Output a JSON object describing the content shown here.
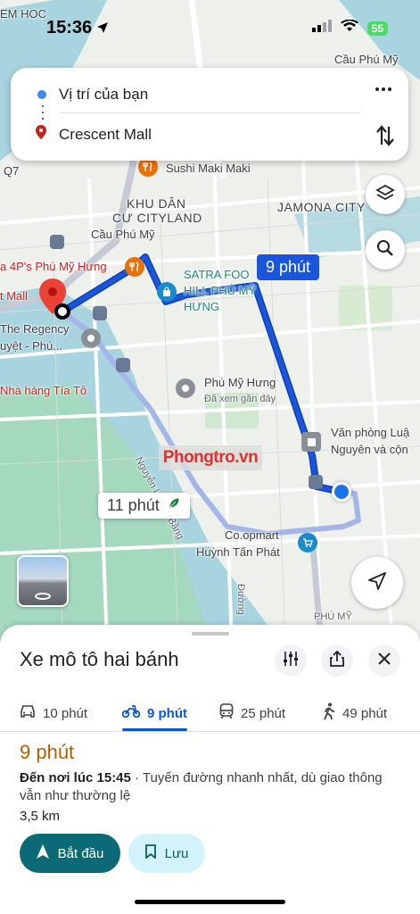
{
  "status_bar": {
    "time": "15:36",
    "battery": "55"
  },
  "route_card": {
    "origin": "Vị trí của bạn",
    "destination": "Crescent Mall",
    "more_icon": "more-vert-icon",
    "swap_icon": "swap-icon"
  },
  "map": {
    "labels": {
      "em_hoc": "EM HOC",
      "cau_phu_my_top": "Cầu Phú Mỹ",
      "sushi": "Sushi Maki Maki",
      "khu_dan": "KHU DÂN",
      "cu_cityland": "CƯ CITYLAND",
      "jamona": "JAMONA CITY",
      "cau_phu_my": "Cầu Phú Mỹ",
      "p4ps": "a 4P's Phú Mỹ Hưng",
      "satra1": "SATRA FOO",
      "satra2": "HILL PHÚ MỸ",
      "satra3": "HƯNG",
      "t_mall": "t Mall",
      "regency1": "The Regency",
      "regency2": "uyệt - Phú...",
      "tia_to": "Nhà hàng Tía Tô",
      "pmh": "Phú Mỹ Hưng",
      "pmh_sub": "Đã xem gần đây",
      "vp1": "Văn phòng Luậ",
      "vp2": "Nguyên và cộn",
      "nguyen_luong_bang": "Nguyễn Lương Bằng",
      "coopmart": "Co.opmart",
      "coopmart2": "Huỳnh Tấn Phát",
      "duong": "Đường",
      "phu_my": "PHÚ MỸ",
      "q7": "Q7"
    },
    "route_primary_time": "9 phút",
    "route_alt_time": "11 phút",
    "watermark": "Phongtro.vn",
    "layers_icon": "layers-icon",
    "search_icon": "search-icon",
    "recenter_icon": "navigation-arrow-icon"
  },
  "sheet": {
    "title": "Xe mô tô hai bánh",
    "tabs": [
      {
        "label": "10 phút",
        "icon": "car-icon"
      },
      {
        "label": "9 phút",
        "icon": "motorbike-icon"
      },
      {
        "label": "25 phút",
        "icon": "transit-icon"
      },
      {
        "label": "49 phút",
        "icon": "walk-icon"
      }
    ],
    "duration": "9 phút",
    "arrival_prefix": "Đến nơi lúc 15:45",
    "arrival_rest": " · Tuyến đường nhanh nhất, dù giao thông vẫn như thường lệ",
    "distance": "3,5 km",
    "start_label": "Bắt đầu",
    "save_label": "Lưu"
  },
  "colors": {
    "route_primary": "#1a56db",
    "route_alt": "#a4b6e8",
    "start_button": "#0c6a76",
    "duration_text": "#b06000",
    "tab_active": "#0b57d0"
  }
}
